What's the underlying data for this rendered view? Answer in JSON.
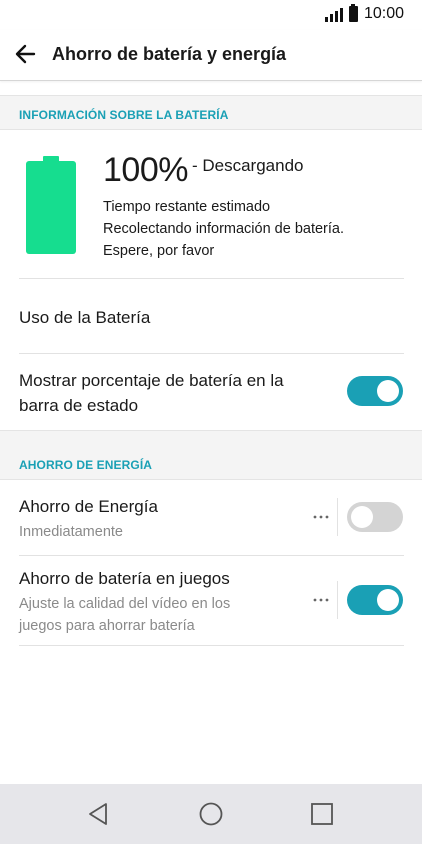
{
  "status_bar": {
    "time": "10:00"
  },
  "header": {
    "title": "Ahorro de batería y energía"
  },
  "battery_section": {
    "header": "INFORMACIÓN SOBRE LA BATERÍA",
    "level_percent": "100%",
    "status": "- Descargando",
    "line1": "Tiempo restante estimado",
    "line2": "Recolectando información de batería.",
    "line3": "Espere, por favor",
    "usage_label": "Uso de la Batería",
    "show_percent_label_line1": "Mostrar porcentaje de batería en la",
    "show_percent_label_line2": "barra de estado",
    "show_percent_on": true
  },
  "energy_section": {
    "header": "AHORRO DE ENERGÍA",
    "power_saver": {
      "title": "Ahorro de Energía",
      "subtitle": "Inmediatamente",
      "on": false
    },
    "game_saver": {
      "title": "Ahorro de batería en juegos",
      "subtitle_line1": "Ajuste la calidad del vídeo en los",
      "subtitle_line2": "juegos para ahorrar batería",
      "on": true
    }
  },
  "colors": {
    "accent": "#1aa0b5",
    "battery_fill": "#16dd8f",
    "toggle_off": "#d4d4d4",
    "nav_bar": "#e6e6ea"
  },
  "icons": {
    "back": "arrow-left-icon",
    "signal": "signal-icon",
    "battery_status": "battery-icon",
    "nav_back": "triangle-back-icon",
    "nav_home": "circle-home-icon",
    "nav_recents": "square-recents-icon",
    "more": "more-dots-icon"
  }
}
